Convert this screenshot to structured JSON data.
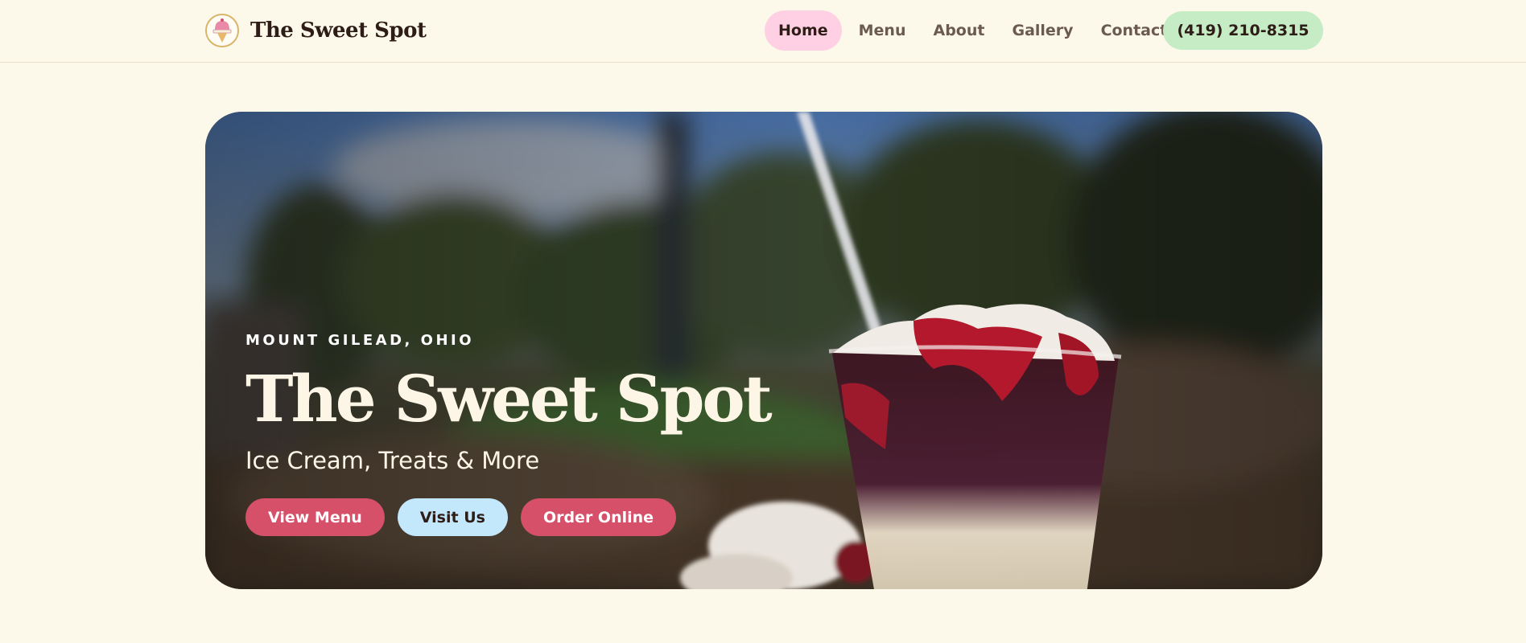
{
  "header": {
    "brand_name": "The Sweet Spot",
    "logo_icon": "ice-cream-logo-icon",
    "nav": [
      {
        "label": "Home",
        "active": true
      },
      {
        "label": "Menu",
        "active": false
      },
      {
        "label": "About",
        "active": false
      },
      {
        "label": "Gallery",
        "active": false
      },
      {
        "label": "Contact",
        "active": false
      }
    ],
    "phone": "(419) 210-8315"
  },
  "hero": {
    "eyebrow": "MOUNT GILEAD, OHIO",
    "title": "The Sweet Spot",
    "subtitle": "Ice Cream, Treats & More",
    "buttons": [
      {
        "label": "View Menu",
        "style": "primary"
      },
      {
        "label": "Visit Us",
        "style": "secondary"
      },
      {
        "label": "Order Online",
        "style": "primary"
      }
    ],
    "image_subject": "sundae-with-cherry-topping-photo"
  },
  "colors": {
    "page_background": "#fdf9ea",
    "active_nav": "#ffd0e4",
    "phone_button": "#c5ecc4",
    "primary_button": "#d6506a",
    "secondary_button": "#c3e8fc",
    "text_dark": "#2e1d17"
  }
}
